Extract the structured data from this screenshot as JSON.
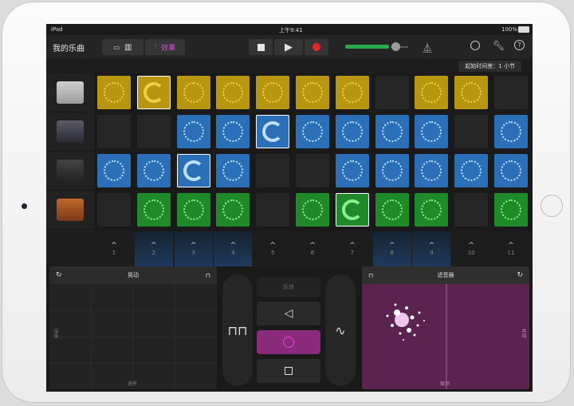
{
  "status": {
    "device": "iPad",
    "time": "上午9:41",
    "battery": "100%"
  },
  "toolbar": {
    "song_title": "我的乐曲",
    "effects_label": "效果",
    "accent": "#e04ad8"
  },
  "subbar": {
    "start_time": "起始时间差：1 小节"
  },
  "instruments": [
    {
      "name": "drum-machine-icon",
      "color": "#b8960f"
    },
    {
      "name": "turntable-icon",
      "color": "#2a6fb8"
    },
    {
      "name": "synth-keyboard-icon",
      "color": "#2a6fb8"
    },
    {
      "name": "vintage-keyboard-icon",
      "color": "#1f8a2a"
    }
  ],
  "grid": [
    [
      "yellow",
      "yellow-active",
      "yellow",
      "yellow",
      "yellow",
      "yellow",
      "yellow",
      "empty",
      "yellow",
      "yellow",
      "empty"
    ],
    [
      "empty",
      "empty",
      "blue",
      "blue",
      "blue-active",
      "blue",
      "blue",
      "blue",
      "blue",
      "empty",
      "blue"
    ],
    [
      "blue",
      "blue",
      "blue-active",
      "blue",
      "empty",
      "empty",
      "blue",
      "blue",
      "blue",
      "blue",
      "blue"
    ],
    [
      "empty",
      "green",
      "green",
      "green",
      "empty",
      "green",
      "green-active",
      "green",
      "green",
      "empty",
      "green"
    ]
  ],
  "triggers": [
    {
      "label": "1",
      "lit": false
    },
    {
      "label": "2",
      "lit": true
    },
    {
      "label": "3",
      "lit": true
    },
    {
      "label": "4",
      "lit": true
    },
    {
      "label": "5",
      "lit": false
    },
    {
      "label": "6",
      "lit": false
    },
    {
      "label": "7",
      "lit": false
    },
    {
      "label": "8",
      "lit": true
    },
    {
      "label": "9",
      "lit": true
    },
    {
      "label": "10",
      "lit": false
    },
    {
      "label": "11",
      "lit": false
    }
  ],
  "left_pad": {
    "title": "晃动",
    "x_label": "速率",
    "y_label": "深度"
  },
  "right_pad": {
    "title": "滤音器",
    "x_label": "截频",
    "y_label": "共鸣"
  },
  "center": {
    "top_label": "反转"
  }
}
